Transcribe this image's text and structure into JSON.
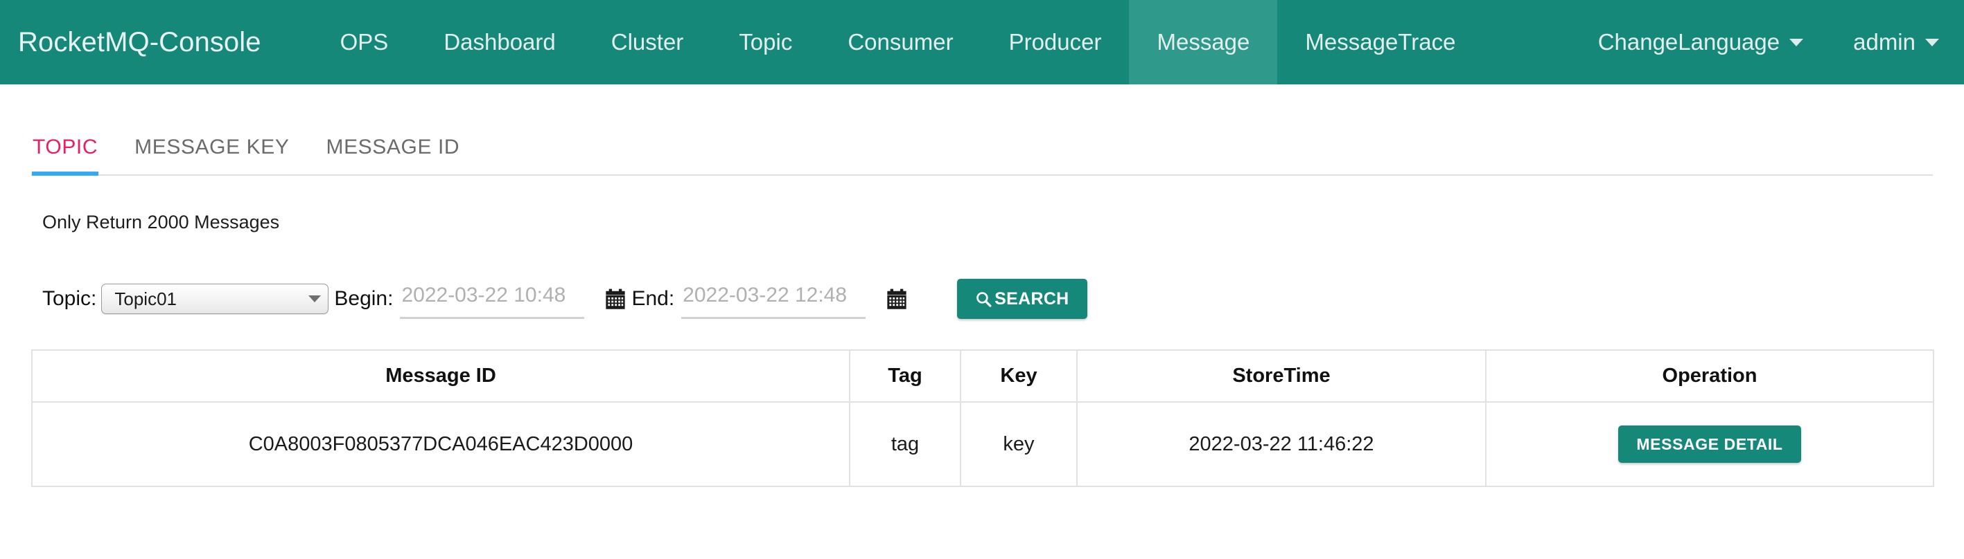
{
  "navbar": {
    "brand": "RocketMQ-Console",
    "items": [
      {
        "label": "OPS",
        "active": false
      },
      {
        "label": "Dashboard",
        "active": false
      },
      {
        "label": "Cluster",
        "active": false
      },
      {
        "label": "Topic",
        "active": false
      },
      {
        "label": "Consumer",
        "active": false
      },
      {
        "label": "Producer",
        "active": false
      },
      {
        "label": "Message",
        "active": true
      },
      {
        "label": "MessageTrace",
        "active": false
      }
    ],
    "right": [
      {
        "label": "ChangeLanguage",
        "caret": true
      },
      {
        "label": "admin",
        "caret": true
      }
    ],
    "bg_color": "#16887a",
    "active_bg_color": "#2f9a8c"
  },
  "tabs": [
    {
      "label": "TOPIC",
      "active": true
    },
    {
      "label": "MESSAGE KEY",
      "active": false
    },
    {
      "label": "MESSAGE ID",
      "active": false
    }
  ],
  "tab_active_color": "#e91e63",
  "tab_underline_color": "#35a9f4",
  "notice": "Only Return 2000 Messages",
  "search_form": {
    "topic_label": "Topic:",
    "topic_value": "Topic01",
    "begin_label": "Begin:",
    "begin_value": "",
    "begin_placeholder": "2022-03-22 10:48",
    "end_label": "End:",
    "end_value": "",
    "end_placeholder": "2022-03-22 12:48",
    "search_label": "SEARCH",
    "search_icon": "search-icon",
    "calendar_icon": "calendar-icon",
    "button_color": "#16887a"
  },
  "table": {
    "headers": [
      "Message ID",
      "Tag",
      "Key",
      "StoreTime",
      "Operation"
    ],
    "rows": [
      {
        "message_id": "C0A8003F0805377DCA046EAC423D0000",
        "tag": "tag",
        "key": "key",
        "store_time": "2022-03-22 11:46:22",
        "operation_label": "MESSAGE DETAIL"
      }
    ]
  }
}
